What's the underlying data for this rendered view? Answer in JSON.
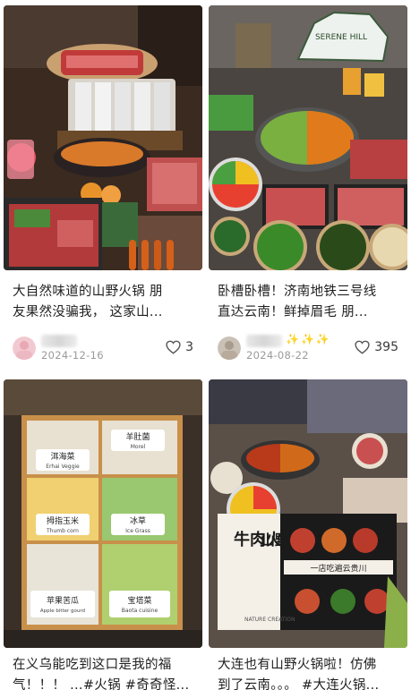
{
  "feed": {
    "cards": [
      {
        "title": "大自然味道的山野火锅 朋\n友果然没骗我， 这家山...",
        "date": "2024-12-16",
        "likes": "3",
        "thumb_text": []
      },
      {
        "title": "卧槽卧槽！济南地铁三号线\n直达云南！鲜掉眉毛 朋...",
        "date": "2024-08-22",
        "likes": "395",
        "sparkles": "✨✨✨",
        "thumb_text": [
          "SERENE HILL"
        ]
      },
      {
        "title": "在义乌能吃到这口是我的福\n气！！！ ...#火锅 #奇奇怪...",
        "thumb_text": [
          "洱海菜",
          "Erhai Veggie",
          "羊肚菌",
          "Morel",
          "拇指玉米",
          "Thumb corn",
          "冰草",
          "Ice Grass",
          "苹果苦瓜",
          "Apple bitter gourd",
          "宝塔菜",
          "Baota cuisine"
        ]
      },
      {
        "title": "大连也有山野火锅啦！仿佛\n到了云南。。。 #大连火锅...",
        "thumb_text": [
          "牛肉火锅",
          "山野自然",
          "一店吃遍云贵川",
          "NATURE CREATION"
        ]
      }
    ]
  },
  "colors": {
    "text_primary": "#1f1f1f",
    "text_secondary": "#9a9a9a",
    "like_icon": "#555555",
    "background": "#ffffff"
  },
  "icons": {
    "like": "heart-outline-icon"
  }
}
